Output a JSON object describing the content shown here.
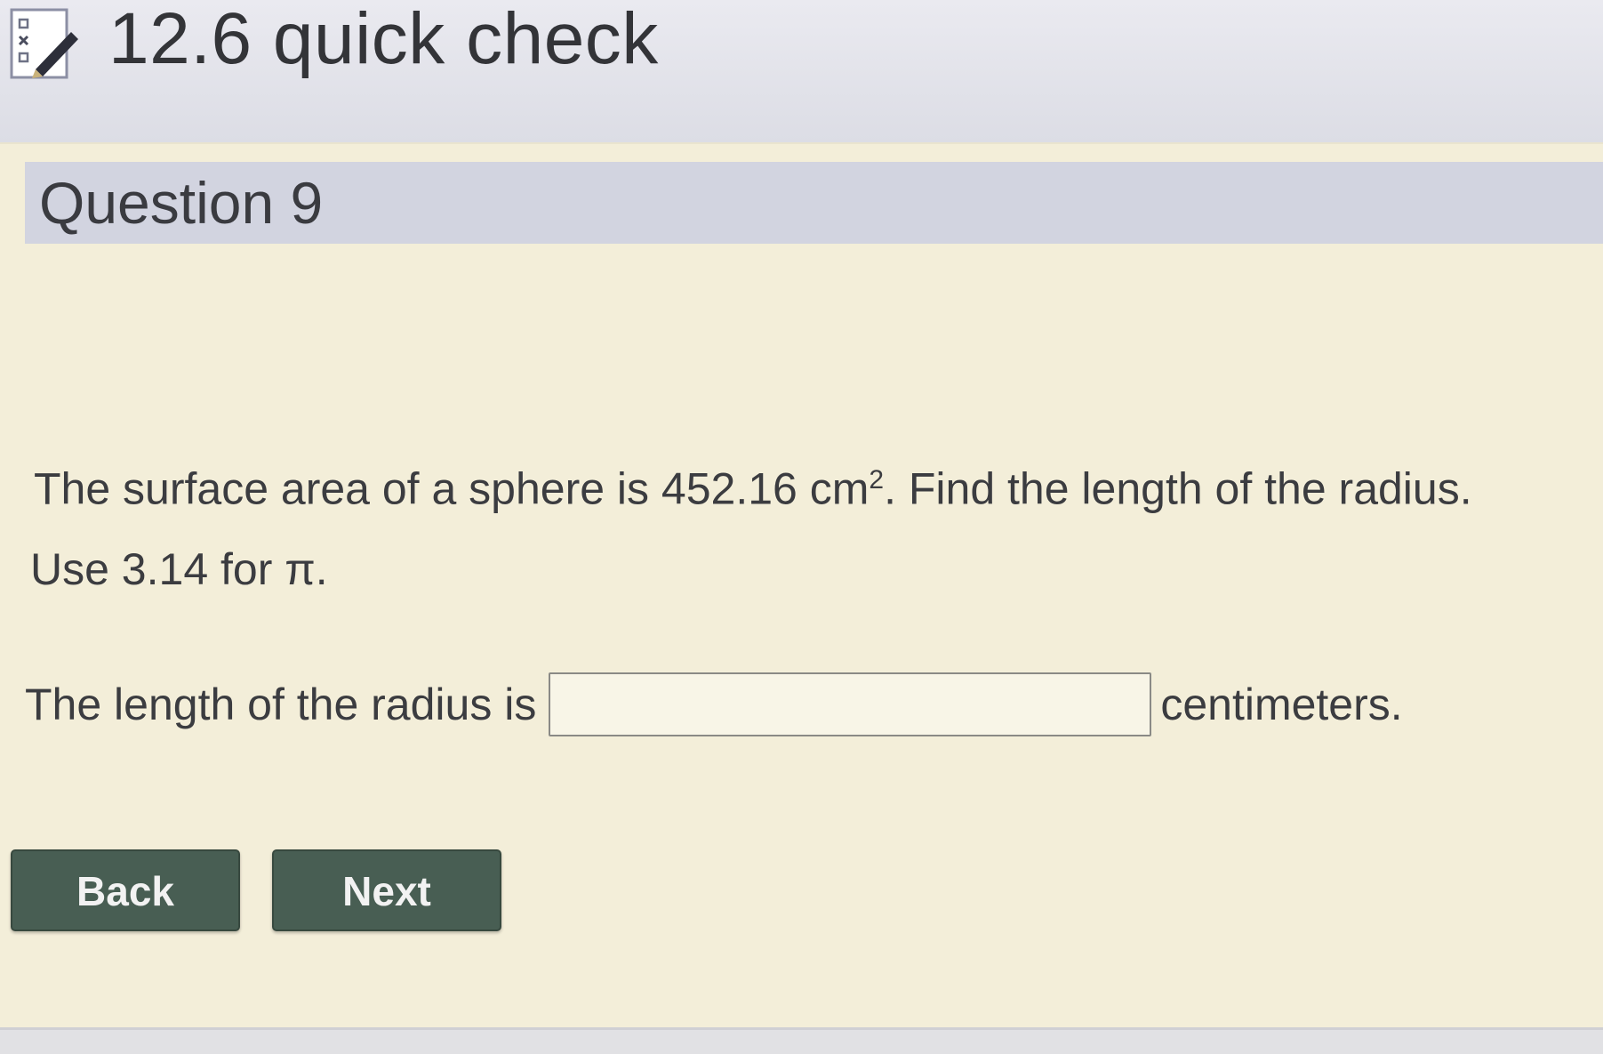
{
  "header": {
    "title": "12.6 quick check",
    "icon": "quiz-checklist-icon"
  },
  "question": {
    "number_label": "Question 9",
    "prompt_before": "The surface area of a sphere is 452.16 cm",
    "prompt_exponent": "2",
    "prompt_after": ".  Find the length of the radius.",
    "hint": "Use 3.14 for π.",
    "answer_prefix": "The length of the radius is",
    "answer_value": "",
    "answer_suffix": "centimeters."
  },
  "navigation": {
    "back_label": "Back",
    "next_label": "Next"
  },
  "colors": {
    "panel_background": "#f3eed9",
    "header_band": "#d2d4e0",
    "button": "#485e53"
  }
}
